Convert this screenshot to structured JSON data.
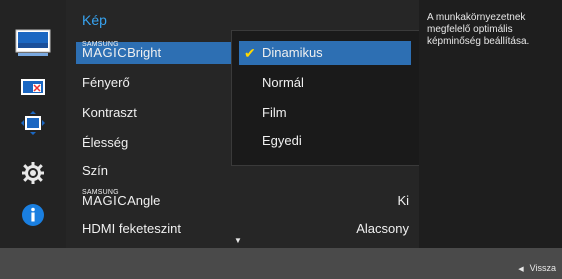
{
  "menu": {
    "title": "Kép",
    "items": [
      {
        "samsung": "SAMSUNG",
        "magic": "MAGIC",
        "label": "Bright",
        "value": ""
      },
      {
        "label": "Fényerő",
        "value": ""
      },
      {
        "label": "Kontraszt",
        "value": ""
      },
      {
        "label": "Élesség",
        "value": ""
      },
      {
        "label": "Szín",
        "value": ""
      },
      {
        "samsung": "SAMSUNG",
        "magic": "MAGIC",
        "label": "Angle",
        "value": "Ki"
      },
      {
        "label": "HDMI feketeszint",
        "value": "Alacsony"
      }
    ]
  },
  "dropdown": {
    "selected_index": 0,
    "options": [
      "Dinamikus",
      "Normál",
      "Film",
      "Egyedi"
    ]
  },
  "help": {
    "text": "A munkakörnyezetnek megfelelő optimális képminőség beállítása."
  },
  "bottom": {
    "return_label": "Vissza"
  },
  "icons": {
    "picture": "monitor-icon",
    "color": "color-icon",
    "size_position": "size-position-icon",
    "setup": "gear-icon",
    "info": "info-icon",
    "scroll_down": "chevron-down-icon",
    "return": "triangle-left-icon",
    "check": "check-icon"
  },
  "colors": {
    "accent": "#37a3f0",
    "highlight": "#2d6fb3",
    "check": "#ffd800"
  }
}
